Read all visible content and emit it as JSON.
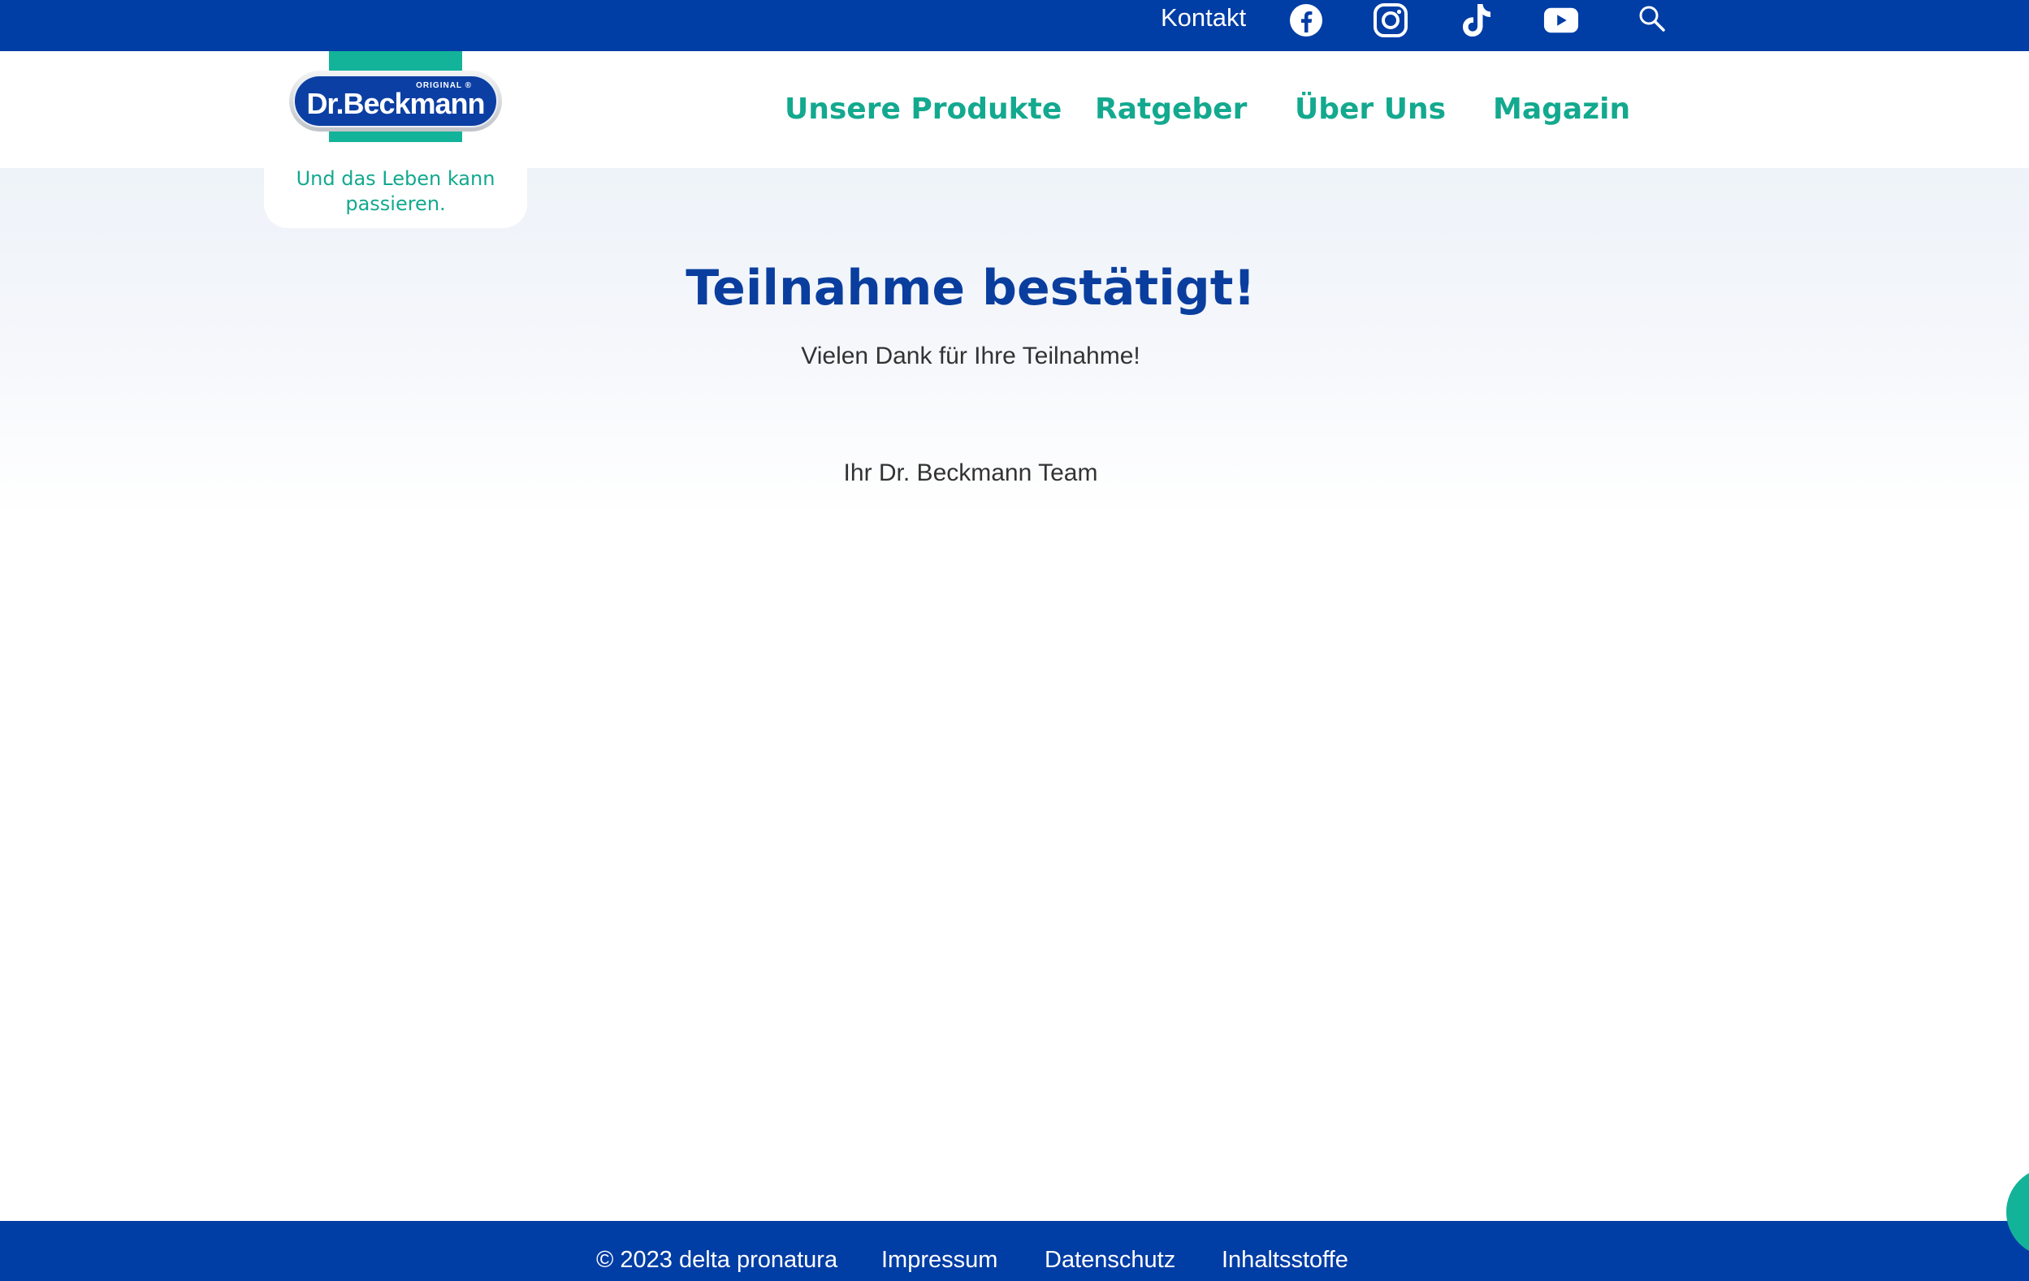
{
  "topbar": {
    "contact_label": "Kontakt",
    "social": [
      {
        "name": "facebook-icon"
      },
      {
        "name": "instagram-icon"
      },
      {
        "name": "tiktok-icon"
      },
      {
        "name": "youtube-icon"
      }
    ],
    "search_icon": "search-icon"
  },
  "brand": {
    "logo_text": "Dr.Beckmann",
    "logo_small": "ORIGINAL ®",
    "tagline": "Und das Leben kann passieren."
  },
  "nav": {
    "items": [
      {
        "label": "Unsere Produkte"
      },
      {
        "label": "Ratgeber"
      },
      {
        "label": "Über Uns"
      },
      {
        "label": "Magazin"
      }
    ]
  },
  "main": {
    "title": "Teilnahme bestätigt!",
    "subtitle": "Vielen Dank für Ihre Teilnahme!",
    "signature": "Ihr Dr. Beckmann Team"
  },
  "footer": {
    "copyright": "© 2023 delta pronatura",
    "links": [
      {
        "label": "Impressum"
      },
      {
        "label": "Datenschutz"
      },
      {
        "label": "Inhaltsstoffe"
      }
    ]
  },
  "colors": {
    "brand_blue": "#003da5",
    "brand_teal": "#13a98f",
    "title_blue": "#0a3e9e"
  }
}
